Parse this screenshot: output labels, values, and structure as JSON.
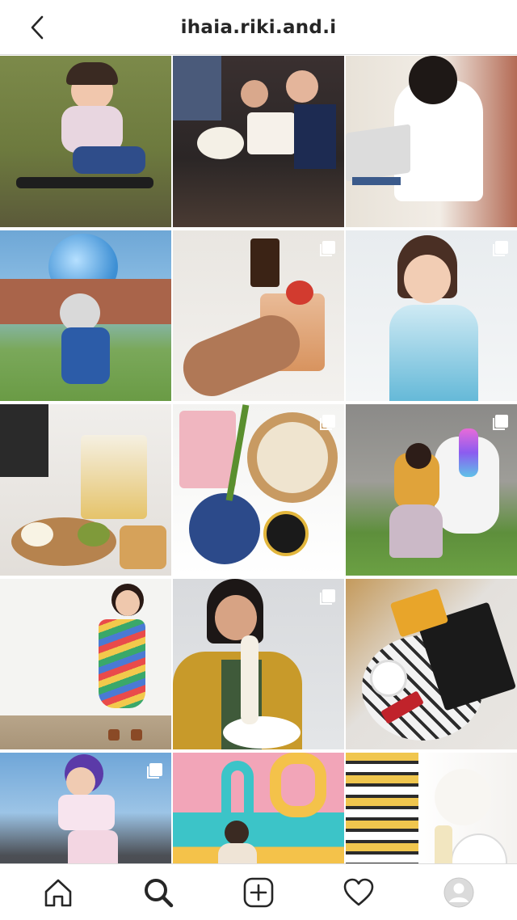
{
  "header": {
    "title": "ihaia.riki.and.i",
    "back_icon": "chevron-left-icon"
  },
  "grid": {
    "posts": [
      {
        "subject": "girl-on-skateboard",
        "multi": false
      },
      {
        "subject": "birthday-cake-family",
        "multi": false
      },
      {
        "subject": "woman-at-laptop",
        "multi": false
      },
      {
        "subject": "child-with-globe-balloon",
        "multi": false
      },
      {
        "subject": "cocktail-drink",
        "multi": true
      },
      {
        "subject": "girl-in-elsa-dress",
        "multi": true
      },
      {
        "subject": "eltora-tortilla-strips-dips",
        "multi": false
      },
      {
        "subject": "dumplings-bamboo-steamer",
        "multi": true
      },
      {
        "subject": "girl-with-unicorn-pony",
        "multi": true
      },
      {
        "subject": "girl-in-zigzag-dress",
        "multi": false
      },
      {
        "subject": "woman-eating-noodles",
        "multi": true
      },
      {
        "subject": "coffee-and-kitkat-flatlay",
        "multi": false
      },
      {
        "subject": "girl-posing-outdoors",
        "multi": true
      },
      {
        "subject": "girl-at-mural-wall",
        "multi": false
      },
      {
        "subject": "woman-with-handbag",
        "multi": false
      }
    ]
  },
  "tabbar": {
    "items": [
      {
        "name": "home-icon"
      },
      {
        "name": "search-icon"
      },
      {
        "name": "new-post-icon"
      },
      {
        "name": "heart-icon"
      },
      {
        "name": "profile-avatar-icon"
      }
    ]
  },
  "colors": {
    "text": "#262626",
    "divider": "#dbdbdb",
    "background": "#ffffff"
  }
}
